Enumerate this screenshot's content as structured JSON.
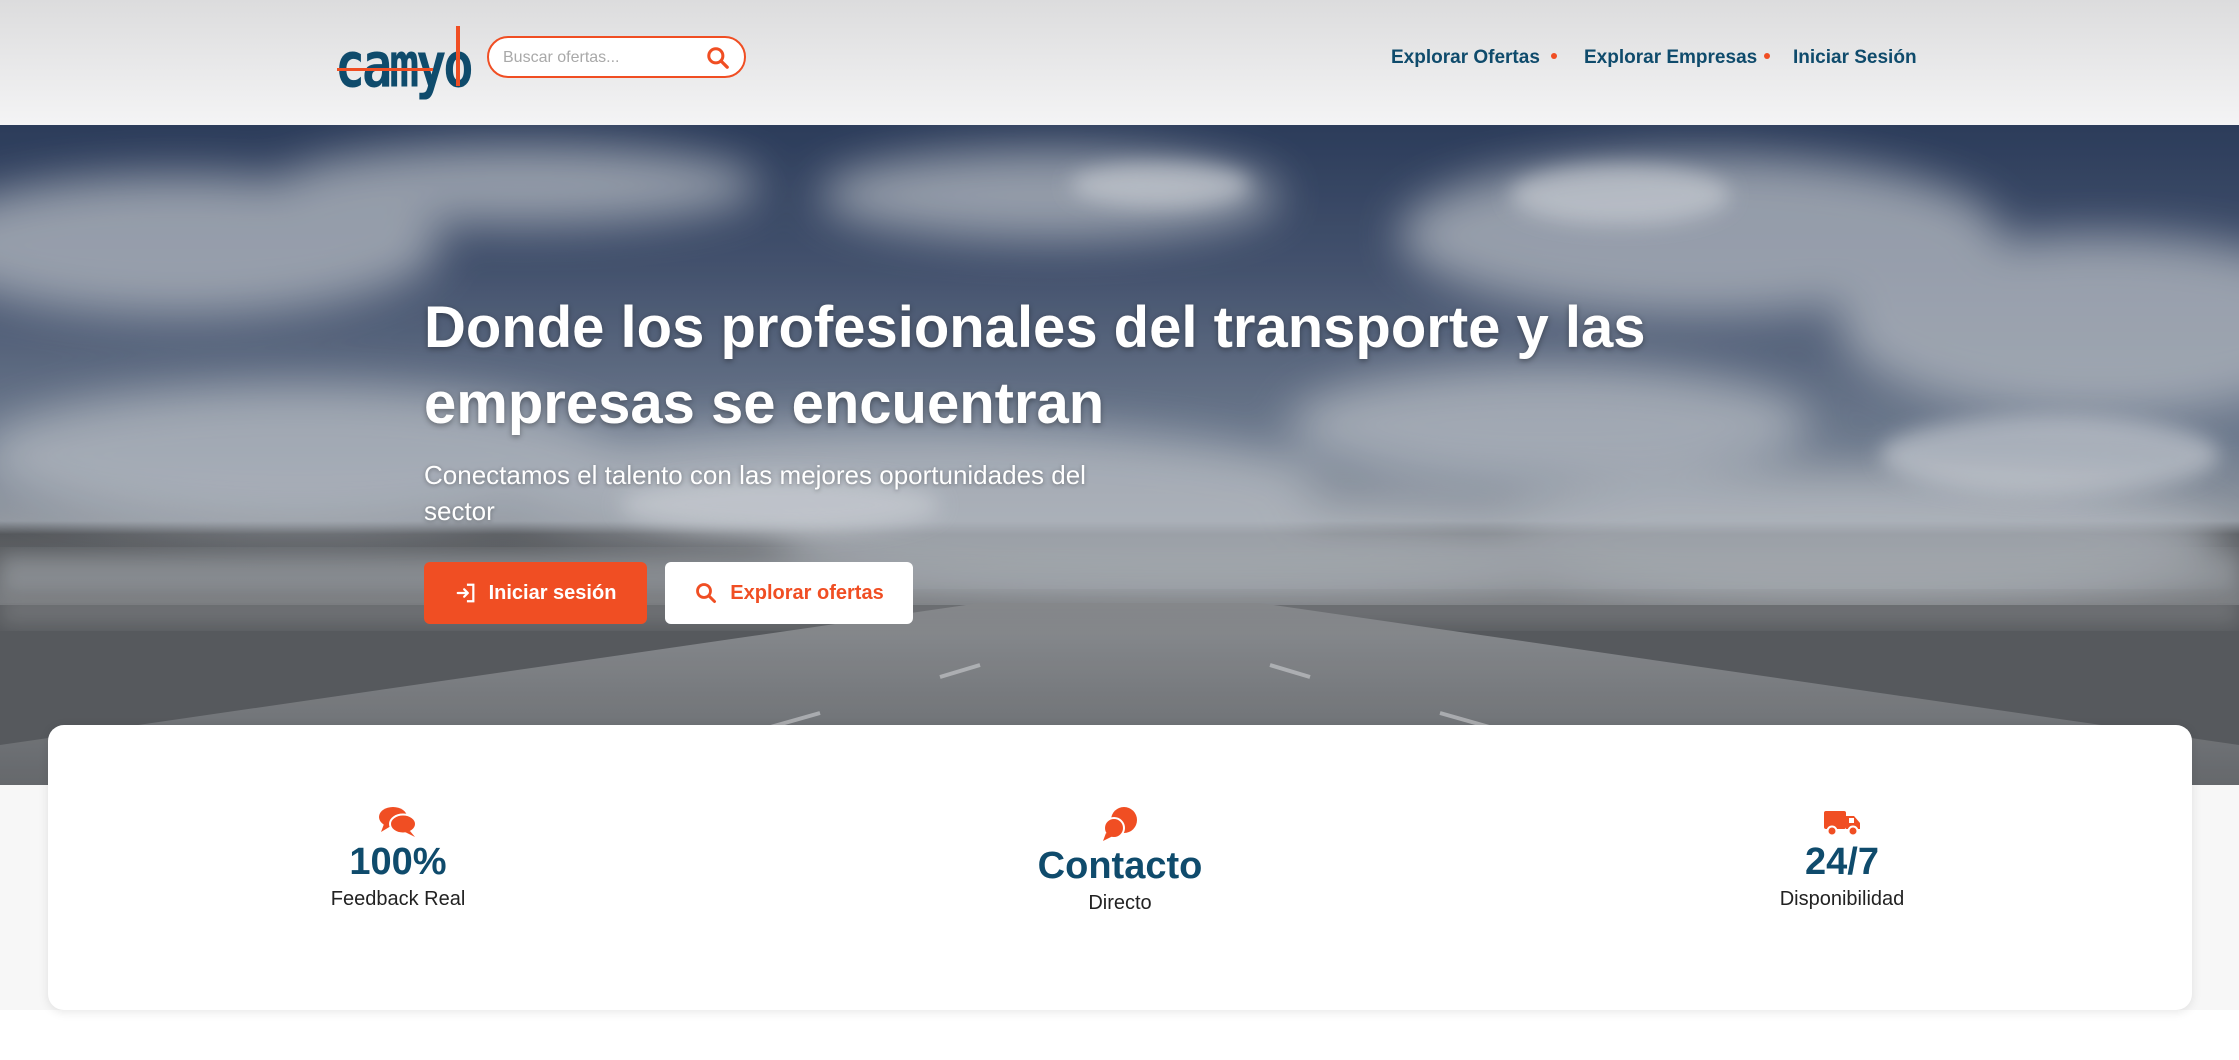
{
  "header": {
    "logo_text": "camyo",
    "search": {
      "placeholder": "Buscar ofertas..."
    },
    "nav": [
      {
        "label": "Explorar Ofertas"
      },
      {
        "label": "Explorar Empresas"
      },
      {
        "label": "Iniciar Sesión"
      }
    ]
  },
  "hero": {
    "title": "Donde los profesionales del transporte y las empresas se encuentran",
    "subtitle": "Conectamos el talento con las mejores oportunidades del sector",
    "primary_button": "Iniciar sesión",
    "secondary_button": "Explorar ofertas"
  },
  "stats": [
    {
      "value": "100%",
      "label": "Feedback Real",
      "icon": "comments-icon"
    },
    {
      "value": "Contacto",
      "label": "Directo",
      "icon": "chat-bubbles-icon"
    },
    {
      "value": "24/7",
      "label": "Disponibilidad",
      "icon": "truck-icon"
    }
  ],
  "colors": {
    "accent": "#f04e23",
    "brand": "#0f4b6c",
    "text": "#222222"
  }
}
